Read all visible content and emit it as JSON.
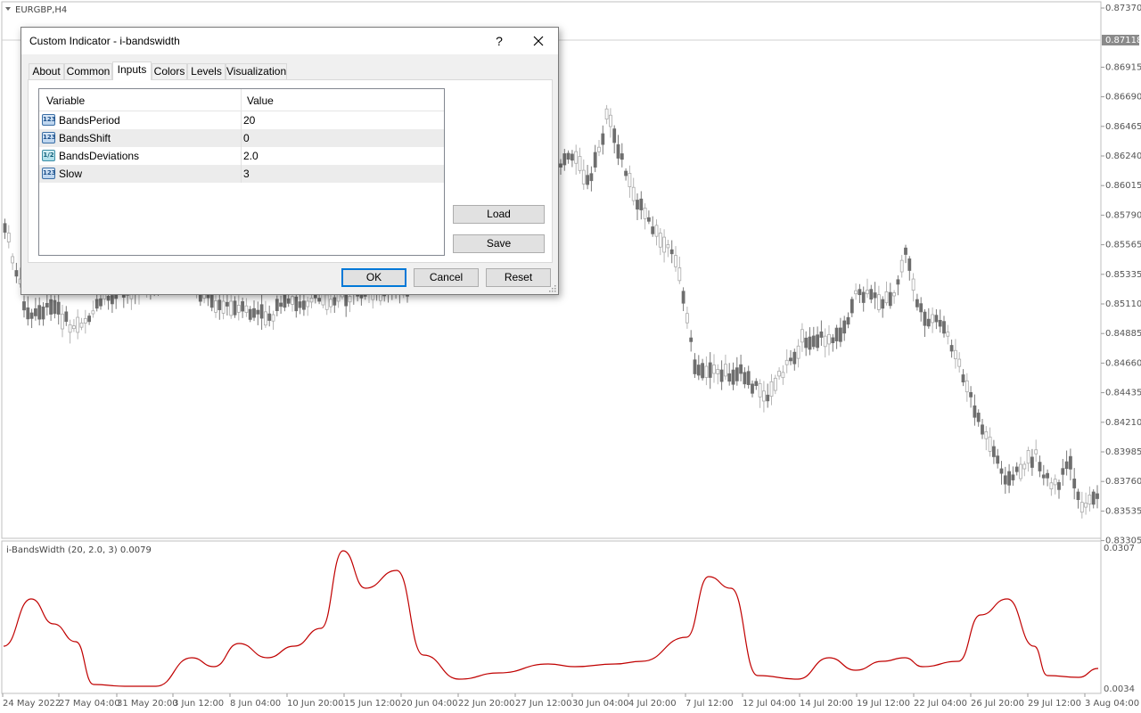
{
  "chart": {
    "symbol_label": "EURGBP,H4",
    "current_price": "0.87118",
    "price_axis": [
      "0.87370",
      "0.87145",
      "0.86915",
      "0.86690",
      "0.86465",
      "0.86240",
      "0.86015",
      "0.85790",
      "0.85565",
      "0.85335",
      "0.85110",
      "0.84885",
      "0.84660",
      "0.84435",
      "0.84210",
      "0.83985",
      "0.83760",
      "0.83535",
      "0.83305"
    ],
    "indicator_label": "i-BandsWidth (20, 2.0, 3) 0.0079",
    "indicator_axis": [
      "0.0307",
      "0.0034"
    ],
    "time_axis": [
      "24 May 2022",
      "27 May 04:00",
      "31 May 20:00",
      "3 Jun 12:00",
      "8 Jun 04:00",
      "10 Jun 20:00",
      "15 Jun 12:00",
      "20 Jun 04:00",
      "22 Jun 20:00",
      "27 Jun 12:00",
      "30 Jun 04:00",
      "4 Jul 20:00",
      "7 Jul 12:00",
      "12 Jul 04:00",
      "14 Jul 20:00",
      "19 Jul 12:00",
      "22 Jul 04:00",
      "26 Jul 20:00",
      "29 Jul 12:00",
      "3 Aug 04:00"
    ],
    "colors": {
      "indicator_line": "#c00000",
      "candle": "#7a7a7a",
      "grid": "#c8c8c8"
    }
  },
  "dialog": {
    "title": "Custom Indicator - i-bandswidth",
    "help_label": "?",
    "tabs": [
      "About",
      "Common",
      "Inputs",
      "Colors",
      "Levels",
      "Visualization"
    ],
    "active_tab": "Inputs",
    "columns": {
      "variable": "Variable",
      "value": "Value"
    },
    "rows": [
      {
        "icon": "123",
        "variable": "BandsPeriod",
        "value": "20"
      },
      {
        "icon": "123",
        "variable": "BandsShift",
        "value": "0"
      },
      {
        "icon": "1/2",
        "variable": "BandsDeviations",
        "value": "2.0"
      },
      {
        "icon": "123",
        "variable": "Slow",
        "value": "3"
      }
    ],
    "buttons": {
      "load": "Load",
      "save": "Save",
      "ok": "OK",
      "cancel": "Cancel",
      "reset": "Reset"
    }
  }
}
